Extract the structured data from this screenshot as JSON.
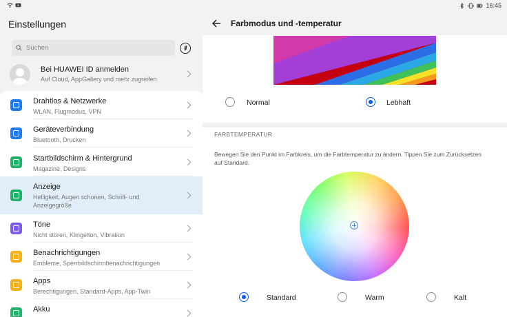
{
  "status_bar": {
    "time": "16:45"
  },
  "left": {
    "title": "Einstellungen",
    "search": {
      "placeholder": "Suchen"
    },
    "search_button_label": "(//",
    "account": {
      "title": "Bei HUAWEI ID anmelden",
      "subtitle": "Auf Cloud, AppGallery und mehr zugreifen"
    },
    "items": [
      {
        "title": "Drahtlos & Netzwerke",
        "subtitle": "WLAN, Flugmodus, VPN",
        "color": "#1f7aee",
        "icon": "wifi-icon"
      },
      {
        "title": "Geräteverbindung",
        "subtitle": "Bluetooth, Drucken",
        "color": "#1f7aee",
        "icon": "device-connection-icon"
      },
      {
        "title": "Startbildschirm & Hintergrund",
        "subtitle": "Magazine, Designs",
        "color": "#23b36c",
        "icon": "wallpaper-icon"
      },
      {
        "title": "Anzeige",
        "subtitle": "Helligkeit, Augen schonen, Schrift- und Anzeigegröße",
        "color": "#23b36c",
        "icon": "display-icon"
      },
      {
        "title": "Töne",
        "subtitle": "Nicht stören, Klingelton, Vibration",
        "color": "#7d5ce6",
        "icon": "sound-icon"
      },
      {
        "title": "Benachrichtigungen",
        "subtitle": "Embleme, Sperrbildschirmbenachrichtigungen",
        "color": "#f5b11a",
        "icon": "bell-icon"
      },
      {
        "title": "Apps",
        "subtitle": "Berechtigungen, Standard-Apps, App-Twin",
        "color": "#f5b11a",
        "icon": "apps-icon"
      },
      {
        "title": "Akku",
        "subtitle": "",
        "color": "#23b36c",
        "icon": "battery-icon"
      }
    ]
  },
  "right": {
    "title": "Farbmodus und -temperatur",
    "color_mode": {
      "options": [
        {
          "label": "Normal",
          "selected": false
        },
        {
          "label": "Lebhaft",
          "selected": true
        }
      ]
    },
    "section_title": "FARBTEMPERATUR",
    "description": "Bewegen Sie den Punkt im Farbkreis, um die Farbtemperatur zu ändern. Tippen Sie zum Zurücksetzen auf Standard.",
    "temperature": {
      "options": [
        {
          "label": "Standard",
          "selected": true
        },
        {
          "label": "Warm",
          "selected": false
        },
        {
          "label": "Kalt",
          "selected": false
        }
      ]
    }
  },
  "colors": {
    "accent": "#0a59f7",
    "selected_row": "#e1eef9"
  }
}
